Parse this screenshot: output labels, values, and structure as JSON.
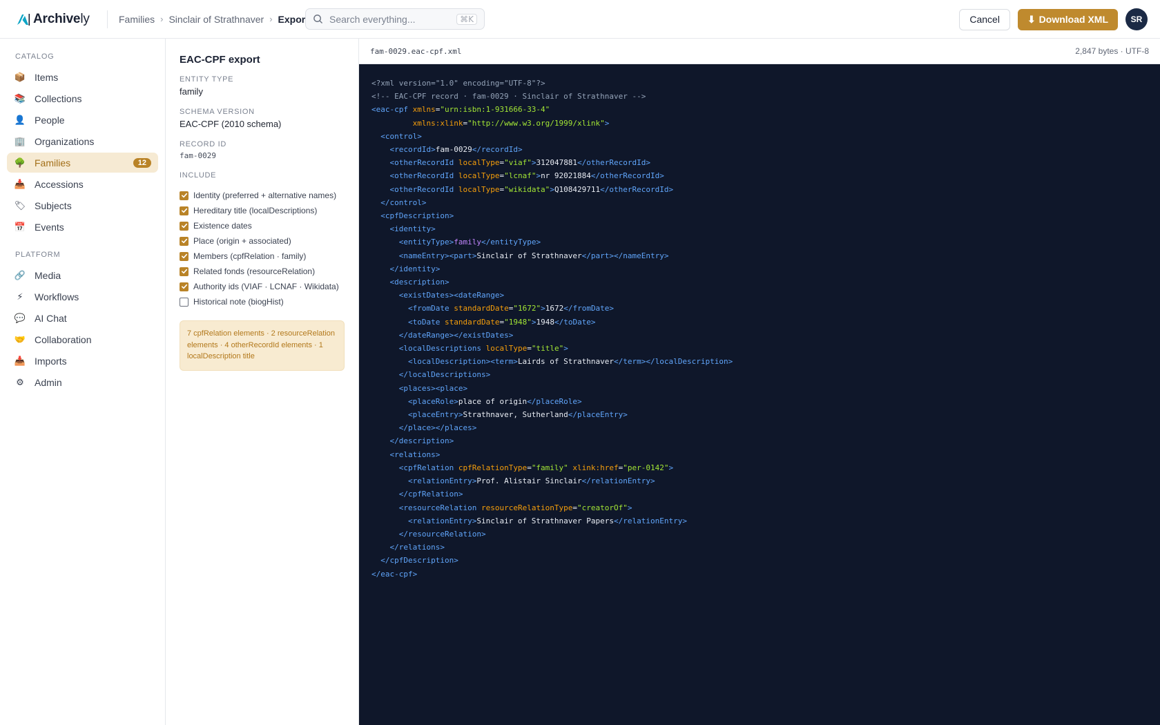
{
  "app": {
    "name_bold": "Archive",
    "name_light": "ly"
  },
  "breadcrumb": [
    "Families",
    "Sinclair of Strathnaver",
    "Export"
  ],
  "search": {
    "placeholder": "Search everything...",
    "shortcut": "⌘K"
  },
  "actions": {
    "cancel": "Cancel",
    "download": "Download XML",
    "download_icon": "⬇"
  },
  "user": {
    "initials": "SR"
  },
  "sidebar": {
    "catalog_title": "CATALOG",
    "catalog": [
      {
        "label": "Items",
        "icon": "box-icon",
        "glyph": "📦"
      },
      {
        "label": "Collections",
        "icon": "collections-icon",
        "glyph": "📚"
      },
      {
        "label": "People",
        "icon": "person-icon",
        "glyph": "👤"
      },
      {
        "label": "Organizations",
        "icon": "building-icon",
        "glyph": "🏢"
      },
      {
        "label": "Families",
        "icon": "tree-icon",
        "glyph": "🌳",
        "badge": "12",
        "active": true
      },
      {
        "label": "Accessions",
        "icon": "inbox-icon",
        "glyph": "📥"
      },
      {
        "label": "Subjects",
        "icon": "tag-icon",
        "glyph": "🏷"
      },
      {
        "label": "Events",
        "icon": "calendar-icon",
        "glyph": "📅"
      }
    ],
    "platform_title": "PLATFORM",
    "platform": [
      {
        "label": "Media",
        "icon": "paperclip-icon",
        "glyph": "🔗"
      },
      {
        "label": "Workflows",
        "icon": "lightning-icon",
        "glyph": "⚡"
      },
      {
        "label": "AI Chat",
        "icon": "chat-icon",
        "glyph": "💬"
      },
      {
        "label": "Collaboration",
        "icon": "handshake-icon",
        "glyph": "🤝"
      },
      {
        "label": "Imports",
        "icon": "import-icon",
        "glyph": "📥"
      },
      {
        "label": "Admin",
        "icon": "gear-icon",
        "glyph": "⚙"
      }
    ]
  },
  "export": {
    "title": "EAC-CPF export",
    "entity_type_label": "ENTITY TYPE",
    "entity_type": "family",
    "schema_label": "SCHEMA VERSION",
    "schema": "EAC-CPF (2010 schema)",
    "record_label": "RECORD ID",
    "record_id": "fam-0029",
    "include_label": "INCLUDE",
    "include": [
      {
        "label": "Identity (preferred + alternative names)",
        "checked": true
      },
      {
        "label": "Hereditary title (localDescriptions)",
        "checked": true
      },
      {
        "label": "Existence dates",
        "checked": true
      },
      {
        "label": "Place (origin + associated)",
        "checked": true
      },
      {
        "label": "Members (cpfRelation · family)",
        "checked": true
      },
      {
        "label": "Related fonds (resourceRelation)",
        "checked": true
      },
      {
        "label": "Authority ids (VIAF · LCNAF · Wikidata)",
        "checked": true
      },
      {
        "label": "Historical note (biogHist)",
        "checked": false
      }
    ],
    "summary": "7 cpfRelation elements · 2 resourceRelation elements · 4 otherRecordId elements · 1 localDescription title"
  },
  "file": {
    "name": "fam-0029.eac-cpf.xml",
    "meta": "2,847 bytes · UTF-8"
  },
  "colors": {
    "accent": "#bf8a2e",
    "code_bg": "#0f172a",
    "tag": "#60a5fa",
    "attr": "#f59e0b",
    "string": "#a3e635",
    "comment": "#94a3b8"
  },
  "xml_lines": [
    [
      [
        "c",
        "<?xml version=\"1.0\" encoding=\"UTF-8\"?>"
      ]
    ],
    [
      [
        "c",
        "<!-- EAC-CPF record · fam-0029 · Sinclair of Strathnaver -->"
      ]
    ],
    [
      [
        "t",
        "<eac-cpf "
      ],
      [
        "a",
        "xmlns"
      ],
      [
        "x",
        "="
      ],
      [
        "s",
        "\"urn:isbn:1-931666-33-4\""
      ]
    ],
    [
      [
        "x",
        "         "
      ],
      [
        "a",
        "xmlns:xlink"
      ],
      [
        "x",
        "="
      ],
      [
        "s",
        "\"http://www.w3.org/1999/xlink\""
      ],
      [
        "t",
        ">"
      ]
    ],
    [
      [
        "x",
        "  "
      ],
      [
        "t",
        "<control>"
      ]
    ],
    [
      [
        "x",
        "    "
      ],
      [
        "t",
        "<recordId>"
      ],
      [
        "x",
        "fam-0029"
      ],
      [
        "t",
        "</recordId>"
      ]
    ],
    [
      [
        "x",
        "    "
      ],
      [
        "t",
        "<otherRecordId "
      ],
      [
        "a",
        "localType"
      ],
      [
        "x",
        "="
      ],
      [
        "s",
        "\"viaf\""
      ],
      [
        "t",
        ">"
      ],
      [
        "x",
        "312047881"
      ],
      [
        "t",
        "</otherRecordId>"
      ]
    ],
    [
      [
        "x",
        "    "
      ],
      [
        "t",
        "<otherRecordId "
      ],
      [
        "a",
        "localType"
      ],
      [
        "x",
        "="
      ],
      [
        "s",
        "\"lcnaf\""
      ],
      [
        "t",
        ">"
      ],
      [
        "x",
        "nr 92021884"
      ],
      [
        "t",
        "</otherRecordId>"
      ]
    ],
    [
      [
        "x",
        "    "
      ],
      [
        "t",
        "<otherRecordId "
      ],
      [
        "a",
        "localType"
      ],
      [
        "x",
        "="
      ],
      [
        "s",
        "\"wikidata\""
      ],
      [
        "t",
        ">"
      ],
      [
        "x",
        "Q108429711"
      ],
      [
        "t",
        "</otherRecordId>"
      ]
    ],
    [
      [
        "x",
        "  "
      ],
      [
        "t",
        "</control>"
      ]
    ],
    [
      [
        "x",
        "  "
      ],
      [
        "t",
        "<cpfDescription>"
      ]
    ],
    [
      [
        "x",
        "    "
      ],
      [
        "t",
        "<identity>"
      ]
    ],
    [
      [
        "x",
        "      "
      ],
      [
        "t",
        "<entityType>"
      ],
      [
        "p",
        "family"
      ],
      [
        "t",
        "</entityType>"
      ]
    ],
    [
      [
        "x",
        "      "
      ],
      [
        "t",
        "<nameEntry><part>"
      ],
      [
        "x",
        "Sinclair of Strathnaver"
      ],
      [
        "t",
        "</part></nameEntry>"
      ]
    ],
    [
      [
        "x",
        "    "
      ],
      [
        "t",
        "</identity>"
      ]
    ],
    [
      [
        "x",
        "    "
      ],
      [
        "t",
        "<description>"
      ]
    ],
    [
      [
        "x",
        "      "
      ],
      [
        "t",
        "<existDates><dateRange>"
      ]
    ],
    [
      [
        "x",
        "        "
      ],
      [
        "t",
        "<fromDate "
      ],
      [
        "a",
        "standardDate"
      ],
      [
        "x",
        "="
      ],
      [
        "s",
        "\"1672\""
      ],
      [
        "t",
        ">"
      ],
      [
        "x",
        "1672"
      ],
      [
        "t",
        "</fromDate>"
      ]
    ],
    [
      [
        "x",
        "        "
      ],
      [
        "t",
        "<toDate "
      ],
      [
        "a",
        "standardDate"
      ],
      [
        "x",
        "="
      ],
      [
        "s",
        "\"1948\""
      ],
      [
        "t",
        ">"
      ],
      [
        "x",
        "1948"
      ],
      [
        "t",
        "</toDate>"
      ]
    ],
    [
      [
        "x",
        "      "
      ],
      [
        "t",
        "</dateRange></existDates>"
      ]
    ],
    [
      [
        "x",
        "      "
      ],
      [
        "t",
        "<localDescriptions "
      ],
      [
        "a",
        "localType"
      ],
      [
        "x",
        "="
      ],
      [
        "s",
        "\"title\""
      ],
      [
        "t",
        ">"
      ]
    ],
    [
      [
        "x",
        "        "
      ],
      [
        "t",
        "<localDescription><term>"
      ],
      [
        "x",
        "Lairds of Strathnaver"
      ],
      [
        "t",
        "</term></localDescription>"
      ]
    ],
    [
      [
        "x",
        "      "
      ],
      [
        "t",
        "</localDescriptions>"
      ]
    ],
    [
      [
        "x",
        "      "
      ],
      [
        "t",
        "<places><place>"
      ]
    ],
    [
      [
        "x",
        "        "
      ],
      [
        "t",
        "<placeRole>"
      ],
      [
        "x",
        "place of origin"
      ],
      [
        "t",
        "</placeRole>"
      ]
    ],
    [
      [
        "x",
        "        "
      ],
      [
        "t",
        "<placeEntry>"
      ],
      [
        "x",
        "Strathnaver, Sutherland"
      ],
      [
        "t",
        "</placeEntry>"
      ]
    ],
    [
      [
        "x",
        "      "
      ],
      [
        "t",
        "</place></places>"
      ]
    ],
    [
      [
        "x",
        "    "
      ],
      [
        "t",
        "</description>"
      ]
    ],
    [
      [
        "x",
        "    "
      ],
      [
        "t",
        "<relations>"
      ]
    ],
    [
      [
        "x",
        "      "
      ],
      [
        "t",
        "<cpfRelation "
      ],
      [
        "a",
        "cpfRelationType"
      ],
      [
        "x",
        "="
      ],
      [
        "s",
        "\"family\""
      ],
      [
        "x",
        " "
      ],
      [
        "a",
        "xlink:href"
      ],
      [
        "x",
        "="
      ],
      [
        "s",
        "\"per-0142\""
      ],
      [
        "t",
        ">"
      ]
    ],
    [
      [
        "x",
        "        "
      ],
      [
        "t",
        "<relationEntry>"
      ],
      [
        "x",
        "Prof. Alistair Sinclair"
      ],
      [
        "t",
        "</relationEntry>"
      ]
    ],
    [
      [
        "x",
        "      "
      ],
      [
        "t",
        "</cpfRelation>"
      ]
    ],
    [
      [
        "x",
        "      "
      ],
      [
        "t",
        "<resourceRelation "
      ],
      [
        "a",
        "resourceRelationType"
      ],
      [
        "x",
        "="
      ],
      [
        "s",
        "\"creatorOf\""
      ],
      [
        "t",
        ">"
      ]
    ],
    [
      [
        "x",
        "        "
      ],
      [
        "t",
        "<relationEntry>"
      ],
      [
        "x",
        "Sinclair of Strathnaver Papers"
      ],
      [
        "t",
        "</relationEntry>"
      ]
    ],
    [
      [
        "x",
        "      "
      ],
      [
        "t",
        "</resourceRelation>"
      ]
    ],
    [
      [
        "x",
        "    "
      ],
      [
        "t",
        "</relations>"
      ]
    ],
    [
      [
        "x",
        "  "
      ],
      [
        "t",
        "</cpfDescription>"
      ]
    ],
    [
      [
        "t",
        "</eac-cpf>"
      ]
    ]
  ]
}
